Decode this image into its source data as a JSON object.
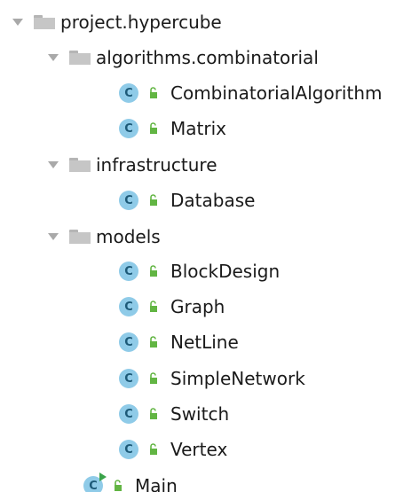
{
  "tree": {
    "root": {
      "label": "project.hypercube",
      "icon": "package-icon"
    },
    "packages": [
      {
        "label": "algorithms.combinatorial",
        "classes": [
          "CombinatorialAlgorithm",
          "Matrix"
        ]
      },
      {
        "label": "infrastructure",
        "classes": [
          "Database"
        ]
      },
      {
        "label": "models",
        "classes": [
          "BlockDesign",
          "Graph",
          "NetLine",
          "SimpleNetwork",
          "Switch",
          "Vertex"
        ]
      }
    ],
    "main_class": {
      "label": "Main",
      "icon": "runnable-class-icon"
    }
  },
  "icons": {
    "class_icon_letter": "C",
    "class_icon_color": "#8fcbe8",
    "class_letter_color": "#1d5a78",
    "access_icon_color": "#62b543",
    "package_icon_color": "#c6c6c6",
    "expand_arrow_color": "#a9a9a9",
    "run_badge_color": "#3aa34a"
  }
}
